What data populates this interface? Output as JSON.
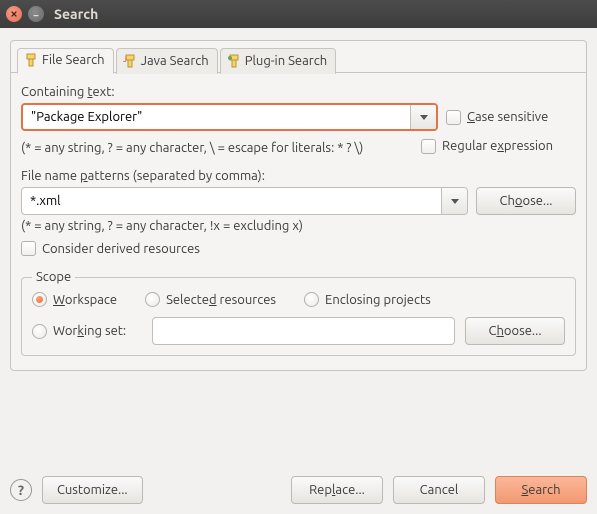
{
  "window": {
    "title": "Search"
  },
  "tabs": {
    "file": {
      "label": "File Search"
    },
    "java": {
      "label": "Java Search"
    },
    "plugin": {
      "label": "Plug-in Search"
    }
  },
  "containing": {
    "label_pre": "Containing ",
    "label_u": "t",
    "label_post": "ext:",
    "value": "\"Package Explorer\"",
    "hint": "(* = any string, ? = any character, \\ = escape for literals: * ? \\)"
  },
  "case_sensitive": {
    "pre": "",
    "u": "C",
    "post": "ase sensitive"
  },
  "regex": {
    "pre": "Regular e",
    "u": "x",
    "post": "pression"
  },
  "filenames": {
    "label_pre": "File name ",
    "label_u": "p",
    "label_post": "atterns (separated by comma):",
    "value": "*.xml",
    "choose_pre": "Ch",
    "choose_u": "o",
    "choose_post": "ose...",
    "hint": "(* = any string, ? = any character, !x = excluding x)"
  },
  "derived": {
    "label": "Consider derived resources"
  },
  "scope": {
    "legend": "Scope",
    "workspace": {
      "pre": "",
      "u": "W",
      "post": "orkspace"
    },
    "selected": {
      "pre": "Selecte",
      "u": "d",
      "post": " resources"
    },
    "enclosing": {
      "pre": "Enclosing projects"
    },
    "workingset": {
      "pre": "Wor",
      "u": "k",
      "post": "ing set:"
    },
    "choose": {
      "pre": "C",
      "u": "h",
      "post": "oose..."
    },
    "working_value": ""
  },
  "footer": {
    "customize": "Customize...",
    "replace_pre": "Rep",
    "replace_u": "l",
    "replace_post": "ace...",
    "cancel": "Cancel",
    "search_pre": "",
    "search_u": "S",
    "search_post": "earch"
  }
}
